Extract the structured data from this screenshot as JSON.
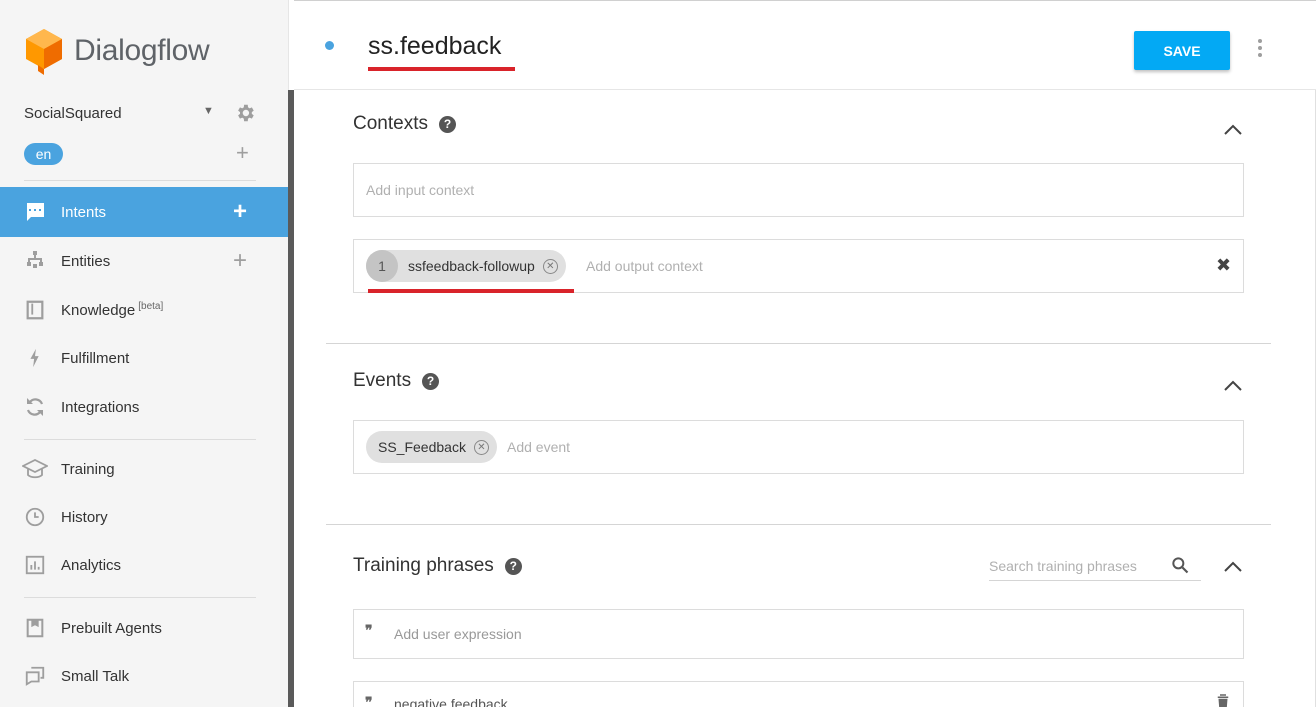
{
  "brand": {
    "name": "Dialogflow"
  },
  "agent": {
    "name": "SocialSquared",
    "language": "en"
  },
  "sidebar": {
    "items": [
      {
        "label": "Intents",
        "icon": "intents-icon",
        "active": true,
        "has_add": true
      },
      {
        "label": "Entities",
        "icon": "entities-icon",
        "has_add": true
      },
      {
        "label": "Knowledge",
        "badge": "[beta]",
        "icon": "knowledge-icon"
      },
      {
        "label": "Fulfillment",
        "icon": "fulfillment-icon"
      },
      {
        "label": "Integrations",
        "icon": "integrations-icon"
      },
      {
        "label": "Training",
        "icon": "training-icon"
      },
      {
        "label": "History",
        "icon": "history-icon"
      },
      {
        "label": "Analytics",
        "icon": "analytics-icon"
      },
      {
        "label": "Prebuilt Agents",
        "icon": "prebuilt-agents-icon"
      },
      {
        "label": "Small Talk",
        "icon": "small-talk-icon"
      }
    ]
  },
  "header": {
    "intent_name": "ss.feedback",
    "save_label": "SAVE"
  },
  "contexts": {
    "title": "Contexts",
    "input_placeholder": "Add input context",
    "output_chip": {
      "lifespan": "1",
      "name": "ssfeedback-followup"
    },
    "output_placeholder": "Add output context"
  },
  "events": {
    "title": "Events",
    "chip": "SS_Feedback",
    "placeholder": "Add event"
  },
  "training_phrases": {
    "title": "Training phrases",
    "search_placeholder": "Search training phrases",
    "add_placeholder": "Add user expression",
    "phrases": [
      "negative feedback"
    ]
  },
  "colors": {
    "accent": "#4aa3df",
    "save_button": "#03a9f4",
    "highlight_underline": "#d9232a",
    "sidebar_bg": "#f5f5f5"
  }
}
